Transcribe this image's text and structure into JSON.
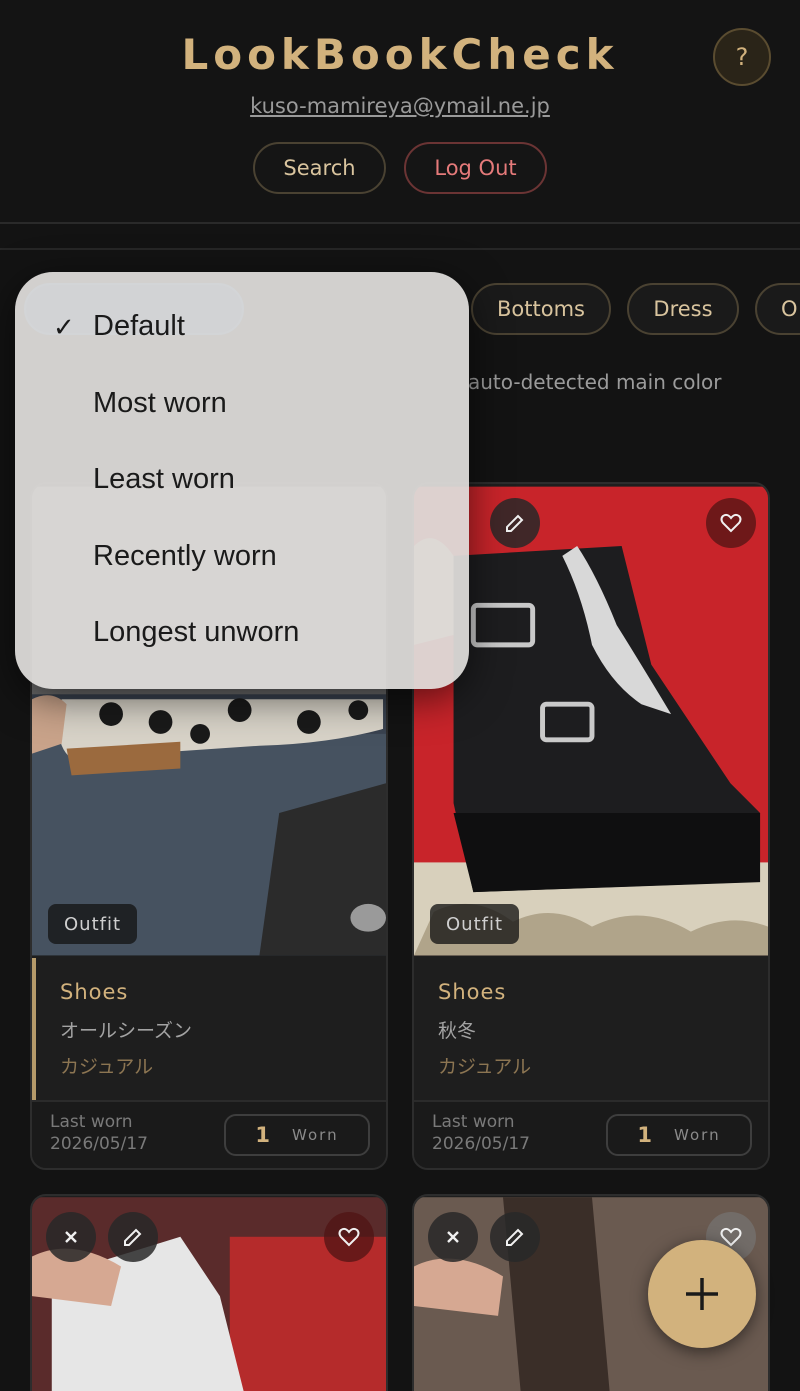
{
  "header": {
    "title": "LookBookCheck",
    "help_label": "?",
    "email": "kuso-mamireya@ymail.ne.jp",
    "search_label": "Search",
    "logout_label": "Log Out"
  },
  "categories": {
    "items": [
      "Bottoms",
      "Dress",
      "O"
    ]
  },
  "hint": "auto-detected main color",
  "sort_menu": {
    "check": "✓",
    "options": [
      "Default",
      "Most worn",
      "Least worn",
      "Recently worn",
      "Longest unworn"
    ],
    "selected": "Default"
  },
  "cards": [
    {
      "tag": "Outfit",
      "category": "Shoes",
      "season": "オールシーズン",
      "style": "カジュアル",
      "last_worn_label": "Last worn",
      "last_worn_date": "2026/05/17",
      "worn_count": "1",
      "worn_label": "Worn"
    },
    {
      "tag": "Outfit",
      "category": "Shoes",
      "season": "秋冬",
      "style": "カジュアル",
      "last_worn_label": "Last worn",
      "last_worn_date": "2026/05/17",
      "worn_count": "1",
      "worn_label": "Worn"
    }
  ],
  "icons": {
    "delete": "x-icon",
    "edit": "pencil-icon",
    "favorite": "heart-icon",
    "add": "plus-icon"
  },
  "colors": {
    "accent": "#d2b27d",
    "background": "#131313",
    "logout": "#e57a7a"
  }
}
